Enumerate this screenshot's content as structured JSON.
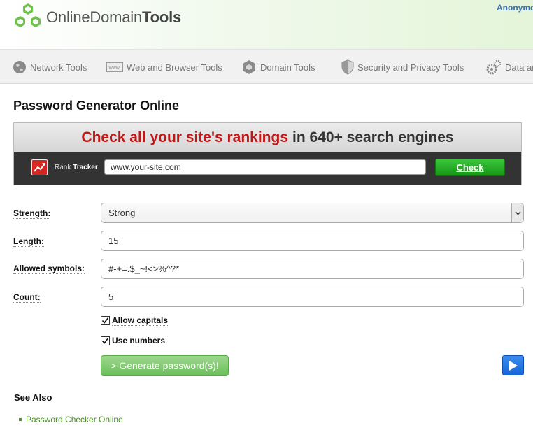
{
  "header": {
    "logo_text_light": "OnlineDomain",
    "logo_text_bold": "Tools",
    "user": "Anonymous"
  },
  "nav": {
    "items": [
      {
        "label": "Network Tools",
        "icon": "globe-icon"
      },
      {
        "label": "Web and Browser Tools",
        "icon": "www-icon"
      },
      {
        "label": "Domain Tools",
        "icon": "hexagon-icon"
      },
      {
        "label": "Security and Privacy Tools",
        "icon": "shield-icon"
      },
      {
        "label": "Data and",
        "icon": "gears-icon"
      }
    ]
  },
  "page": {
    "title": "Password Generator Online"
  },
  "ad": {
    "headline_red": "Check all your site's rankings",
    "headline_rest": "in 640+ search engines",
    "brand_light": "Rank",
    "brand_bold": "Tracker",
    "input_value": "www.your-site.com",
    "button": "Check",
    "colors": {
      "red": "#c01818",
      "green": "#159815"
    }
  },
  "form": {
    "strength_label": "Strength:",
    "strength_value": "Strong",
    "length_label": "Length:",
    "length_value": "15",
    "symbols_label": "Allowed symbols:",
    "symbols_value": "#-+=.$_~!<>%^?*",
    "count_label": "Count:",
    "count_value": "5",
    "allow_capitals_label": "Allow capitals",
    "allow_capitals_checked": true,
    "use_numbers_label": "Use numbers",
    "use_numbers_checked": true,
    "generate_button": "> Generate password(s)!"
  },
  "see_also": {
    "heading": "See Also",
    "links": [
      "Password Checker Online"
    ]
  },
  "accent_color": "#6bbf5a"
}
